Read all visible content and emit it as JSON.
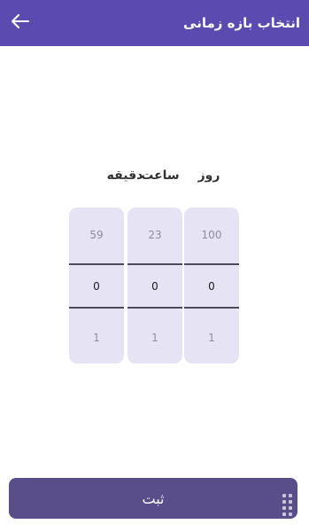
{
  "header": {
    "title": "انتخاب بازه زمانی",
    "back_icon": "arrow-left-icon",
    "background": "#5b4bb0"
  },
  "picker": {
    "columns": [
      {
        "label": "روز",
        "prev": "100",
        "current": "0",
        "next": "1"
      },
      {
        "label": "ساعت",
        "prev": "23",
        "current": "0",
        "next": "1"
      },
      {
        "label": "دقیقه",
        "prev": "59",
        "current": "0",
        "next": "1"
      }
    ],
    "column_background": "#e6e4f4"
  },
  "footer": {
    "submit_label": "ثبت",
    "submit_color": "#5a4e8a"
  }
}
